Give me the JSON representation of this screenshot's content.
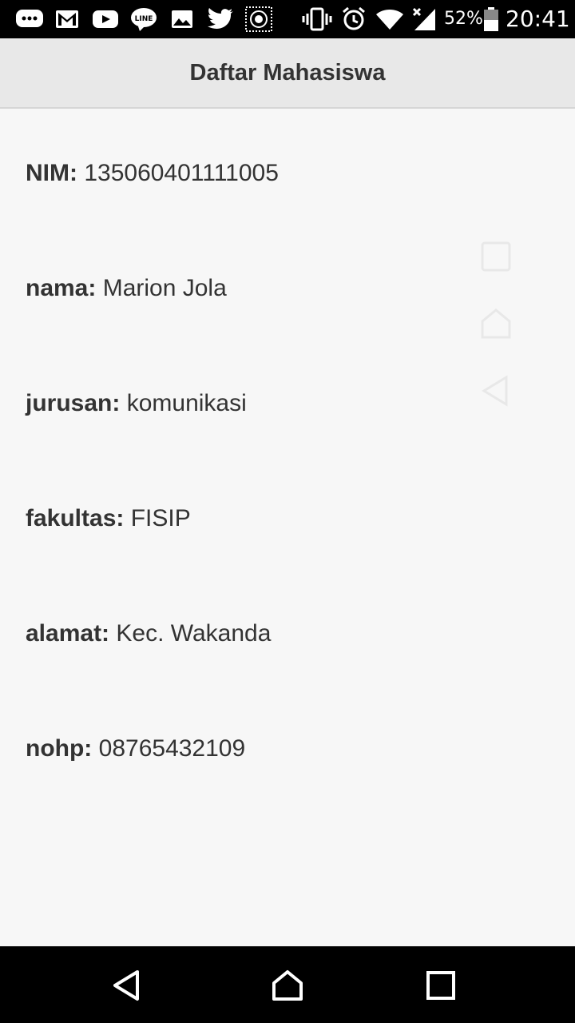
{
  "status_bar": {
    "icons_left": [
      "chat-bubble-icon",
      "gmail-icon",
      "youtube-icon",
      "line-icon",
      "gallery-icon",
      "twitter-icon",
      "app-emblem-icon"
    ],
    "icons_right": [
      "vibrate-icon",
      "alarm-icon",
      "wifi-icon",
      "signal-icon",
      "battery-icon"
    ],
    "battery_percent": "52%",
    "time": "20:41"
  },
  "app_bar": {
    "title": "Daftar Mahasiswa"
  },
  "fields": [
    {
      "label": "NIM:",
      "value": "135060401111005"
    },
    {
      "label": "nama:",
      "value": "Marion Jola"
    },
    {
      "label": "jurusan:",
      "value": "komunikasi"
    },
    {
      "label": "fakultas:",
      "value": "FISIP"
    },
    {
      "label": "alamat:",
      "value": "Kec. Wakanda"
    },
    {
      "label": "nohp:",
      "value": "08765432109"
    }
  ],
  "nav_bar": {
    "buttons": [
      "back-icon",
      "home-icon",
      "recents-icon"
    ]
  },
  "colors": {
    "background": "#f7f7f7",
    "app_bar": "#e8e8e8",
    "text": "#333333",
    "system_bar": "#000000"
  }
}
